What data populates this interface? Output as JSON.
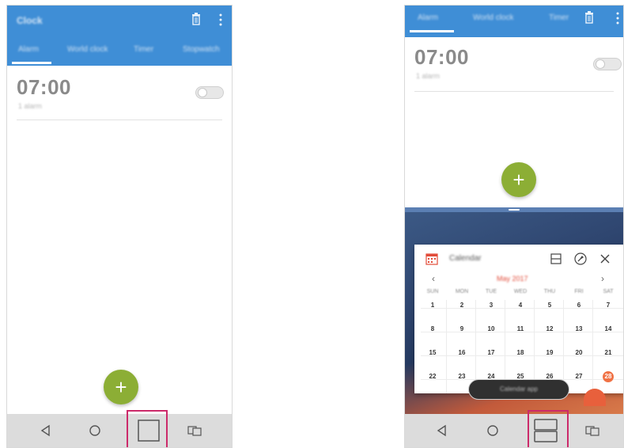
{
  "left_screen": {
    "app_title": "Clock",
    "tabs": [
      "Alarm",
      "World clock",
      "Timer",
      "Stopwatch"
    ],
    "alarm": {
      "time": "07:00",
      "repeat": "1 alarm",
      "enabled": false
    },
    "fab_label": "+",
    "nav": [
      "back-icon",
      "home-icon",
      "recents-icon",
      "dual-window-icon"
    ]
  },
  "right_screen": {
    "tabs": [
      "Alarm",
      "World clock",
      "Timer"
    ],
    "alarm": {
      "time": "07:00",
      "repeat": "1 alarm",
      "enabled": false
    },
    "fab_label": "+",
    "calendar": {
      "title": "Calendar",
      "month": "May 2017",
      "prev": "‹",
      "next": "›",
      "weekdays": [
        "SUN",
        "MON",
        "TUE",
        "WED",
        "THU",
        "FRI",
        "SAT"
      ],
      "weeks": [
        [
          "1",
          "2",
          "3",
          "4",
          "5",
          "6",
          "7"
        ],
        [
          "8",
          "9",
          "10",
          "11",
          "12",
          "13",
          "14"
        ],
        [
          "15",
          "16",
          "17",
          "18",
          "19",
          "20",
          "21"
        ],
        [
          "22",
          "23",
          "24",
          "25",
          "26",
          "27",
          "28"
        ]
      ],
      "today": "28"
    },
    "toast": "Calendar app",
    "nav": [
      "back-icon",
      "home-icon",
      "split-screen-icon",
      "dual-window-icon"
    ]
  },
  "colors": {
    "appbar": "#3f8ed6",
    "fab": "#8cae35",
    "highlight": "#cc2a6a",
    "calendar_accent": "#e24c3a"
  }
}
